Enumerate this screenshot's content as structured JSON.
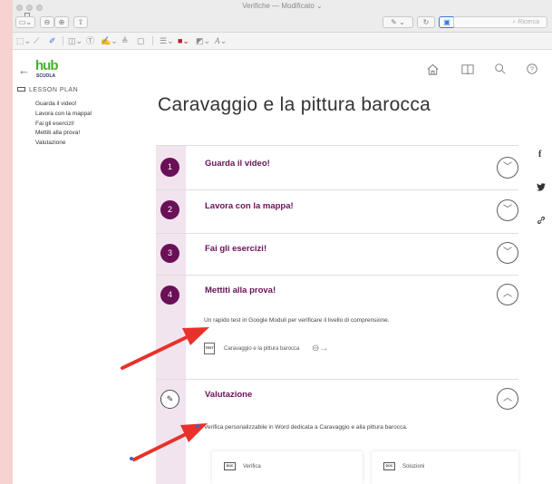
{
  "window": {
    "title": "Verifiche",
    "title_status": "— Modificato",
    "search_placeholder": "Ricerca"
  },
  "header": {
    "logo_main": "hub",
    "logo_sub": "SCUOLA",
    "icons": [
      "home-icon",
      "book-icon",
      "search-icon",
      "help-icon"
    ]
  },
  "toc": {
    "heading": "LESSON PLAN",
    "items": [
      "Guarda il video!",
      "Lavora con la mappa!",
      "Fai gli esercizi!",
      "Mettiti alla prova!",
      "Valutazione"
    ]
  },
  "page": {
    "title": "Caravaggio e la pittura barocca"
  },
  "steps": [
    {
      "num": "1",
      "title": "Guarda il video!"
    },
    {
      "num": "2",
      "title": "Lavora con la mappa!"
    },
    {
      "num": "3",
      "title": "Fai gli esercizi!"
    },
    {
      "num": "4",
      "title": "Mettiti alla prova!",
      "desc": "Un rapido test in Google Moduli per verificare il livello di comprensione.",
      "attachment_icon": "TEST",
      "attachment_label": "Caravaggio e la pittura barocca"
    },
    {
      "title": "Valutazione",
      "desc": "Verifica personalizzabile in Word dedicata a Caravaggio e alla pittura barocca.",
      "docs": [
        {
          "icon": "DOC",
          "label": "Verifica"
        },
        {
          "icon": "DOC",
          "label": "Soluzioni"
        }
      ]
    }
  ],
  "share": [
    "facebook-icon",
    "twitter-icon",
    "link-icon"
  ],
  "colors": {
    "accent": "#6a1057",
    "rail": "#f1e4ee",
    "logo_green": "#47b02d",
    "annotation_red": "#e8312a"
  }
}
